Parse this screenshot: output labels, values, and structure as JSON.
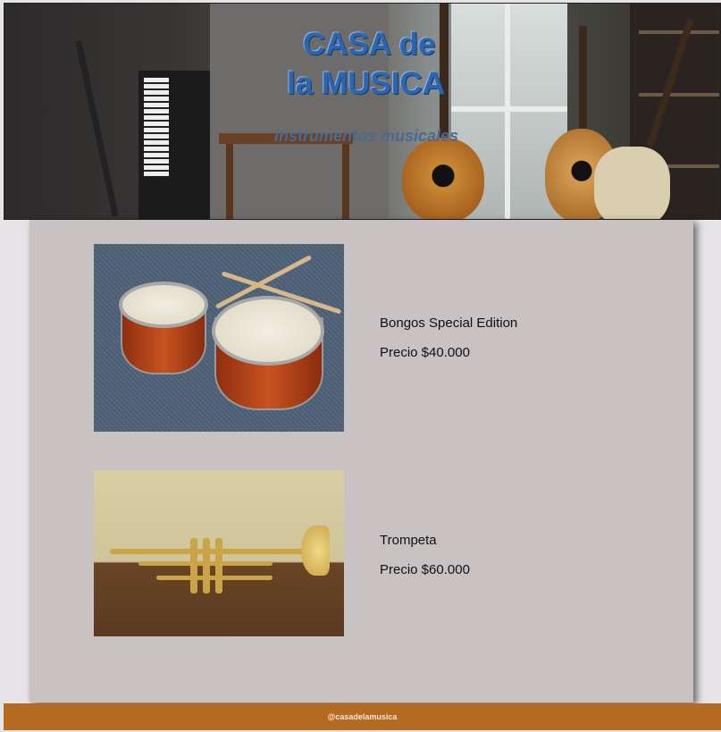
{
  "header": {
    "title_line1": "CASA de",
    "title_line2": "la  MUSICA",
    "tagline": "instrumentos musicales"
  },
  "products": [
    {
      "name": "Bongos Special Edition",
      "price": "Precio $40.000",
      "image": "bongos-photo"
    },
    {
      "name": "Trompeta",
      "price": "Precio $60.000",
      "image": "trumpet-photo"
    }
  ],
  "footer": {
    "handle": "@casadelamusica"
  },
  "colors": {
    "title": "#2d66b0",
    "main_bg": "#c8c2c3",
    "footer_bg": "#b56a22",
    "page_bg": "#e6e4e6"
  }
}
